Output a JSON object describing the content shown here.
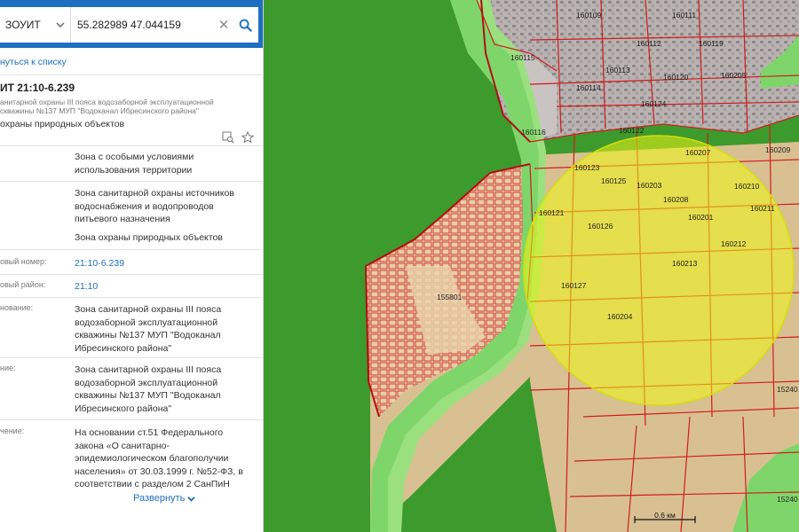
{
  "search": {
    "layer": "ЗОУИТ",
    "coords": "55.282989 47.044159"
  },
  "back_link": "нуться к списку",
  "object": {
    "title": "ИТ 21:10-6.239",
    "subtitle": "анитарной охраны III пояса водозаборной эксплуатационной скважины №137 МУП \"Водоканал Ибресинского района\"",
    "type": "охраны природных объектов"
  },
  "rows": [
    {
      "label": "",
      "values": [
        "Зона с особыми условиями использования территории"
      ],
      "link": false
    },
    {
      "label": "",
      "values": [
        "Зона санитарной охраны источников водоснабжения и водопроводов питьевого назначения",
        "Зона охраны природных объектов"
      ],
      "link": false
    },
    {
      "label": "овый номер:",
      "values": [
        "21:10-6.239"
      ],
      "link": true
    },
    {
      "label": "овый район:",
      "values": [
        "21:10"
      ],
      "link": true
    },
    {
      "label": "нование:",
      "values": [
        "Зона санитарной охраны III пояса водозаборной эксплуатационной скважины №137 МУП \"Водоканал Ибресинского района\""
      ],
      "link": false
    },
    {
      "label": "ние:",
      "values": [
        "Зона санитарной охраны III пояса водозаборной эксплуатационной скважины №137 МУП \"Водоканал Ибресинского района\""
      ],
      "link": false
    },
    {
      "label": "чение:",
      "values": [
        "На основании ст.51 Федерального закона «О санитарно-эпидемиологическом благополучии населения» от 30.03.1999 г. №52-ФЗ, в соответствии с разделом 2 СанПиН"
      ],
      "link": false
    }
  ],
  "expand_label": "Развернуть",
  "map": {
    "scale": "0.6 км",
    "parcels": [
      "160109",
      "160111",
      "160112",
      "160119",
      "160115",
      "160113",
      "160114",
      "160120",
      "160124",
      "160116",
      "160122",
      "160207",
      "160205",
      "160209",
      "160123",
      "160125",
      "160203",
      "160208",
      "160210",
      "160201",
      "160121",
      "160126",
      "160211",
      "160212",
      "160213",
      "155801",
      "160127",
      "160204",
      "15240",
      "15240"
    ]
  },
  "colors": {
    "accent": "#1e6fc0",
    "forest": "#3d9a2c",
    "buffer": "#7ed66a",
    "field": "#d9c092",
    "zone_fill": "#eef514",
    "parcel_line": "#d11c1c"
  }
}
